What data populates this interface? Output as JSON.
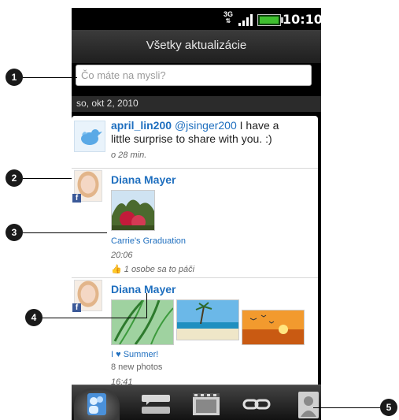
{
  "status": {
    "network": "3G",
    "time": "10:10"
  },
  "header": {
    "title": "Všetky aktualizácie"
  },
  "status_input": {
    "placeholder": "Čo máte na mysli?"
  },
  "date_header": "so, okt 2, 2010",
  "feed": [
    {
      "user": "april_lin200",
      "mention": "@jsinger200",
      "line1": " I have a",
      "line2": "little surprise to share with you. :)",
      "time": "o 28 min.",
      "source_icon": "twitter-bird-icon"
    },
    {
      "user": "Diana Mayer",
      "caption": "Carrie's Graduation",
      "time": "20:06",
      "likes": "1 osobe sa to páči",
      "source_icon": "facebook-icon"
    },
    {
      "user": "Diana Mayer",
      "album": "I ♥ Summer!",
      "count": "8 new photos",
      "time": "16:41",
      "source_icon": "facebook-icon"
    }
  ],
  "callouts": [
    "1",
    "2",
    "3",
    "4",
    "5"
  ],
  "bottom_tabs": [
    {
      "name": "all-updates-tab",
      "icon": "people-icon",
      "active": true
    },
    {
      "name": "status-tab",
      "icon": "chat-list-icon"
    },
    {
      "name": "photos-tab",
      "icon": "film-icon"
    },
    {
      "name": "links-tab",
      "icon": "link-icon"
    },
    {
      "name": "profile-tab",
      "icon": "person-icon"
    }
  ],
  "colors": {
    "link_blue": "#1f6fbf",
    "facebook": "#3b5998",
    "battery": "#3fbf2f"
  }
}
